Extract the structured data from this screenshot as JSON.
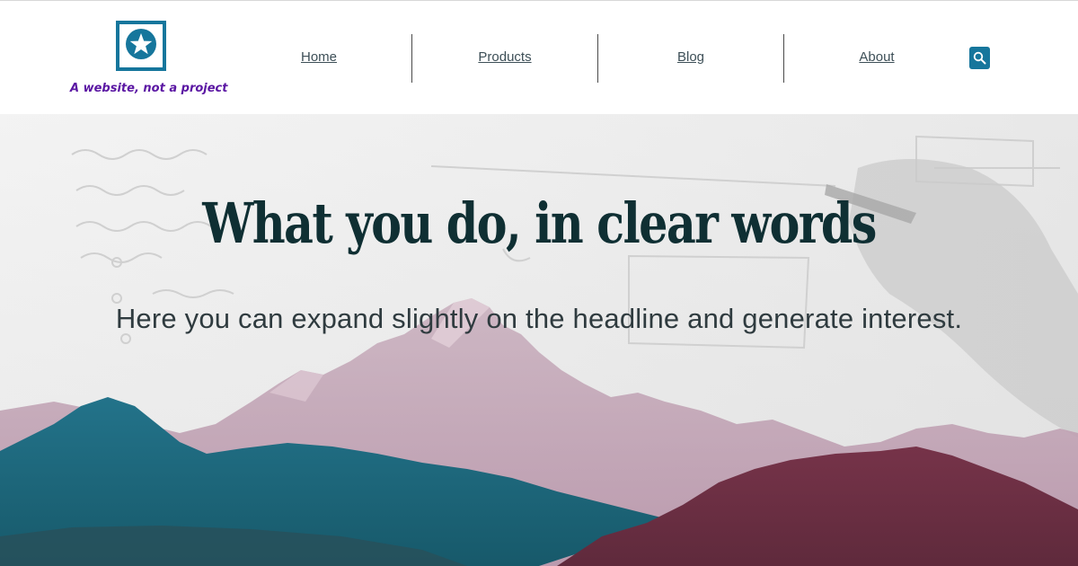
{
  "header": {
    "tagline": "A website, not a project",
    "logo_icon": "star-icon",
    "brand_color": "#16769c",
    "tagline_color": "#5b17a3",
    "nav": [
      {
        "label": "Home"
      },
      {
        "label": "Products"
      },
      {
        "label": "Blog"
      },
      {
        "label": "About"
      }
    ],
    "search_icon": "search-icon"
  },
  "hero": {
    "headline": "What you do, in clear words",
    "subheadline": "Here you can expand slightly on the headline and generate interest.",
    "colors": {
      "teal_mountain": "#1d6a7b",
      "maroon_mountain": "#6c3044",
      "snow_peaks": "#c8a9b7"
    }
  }
}
